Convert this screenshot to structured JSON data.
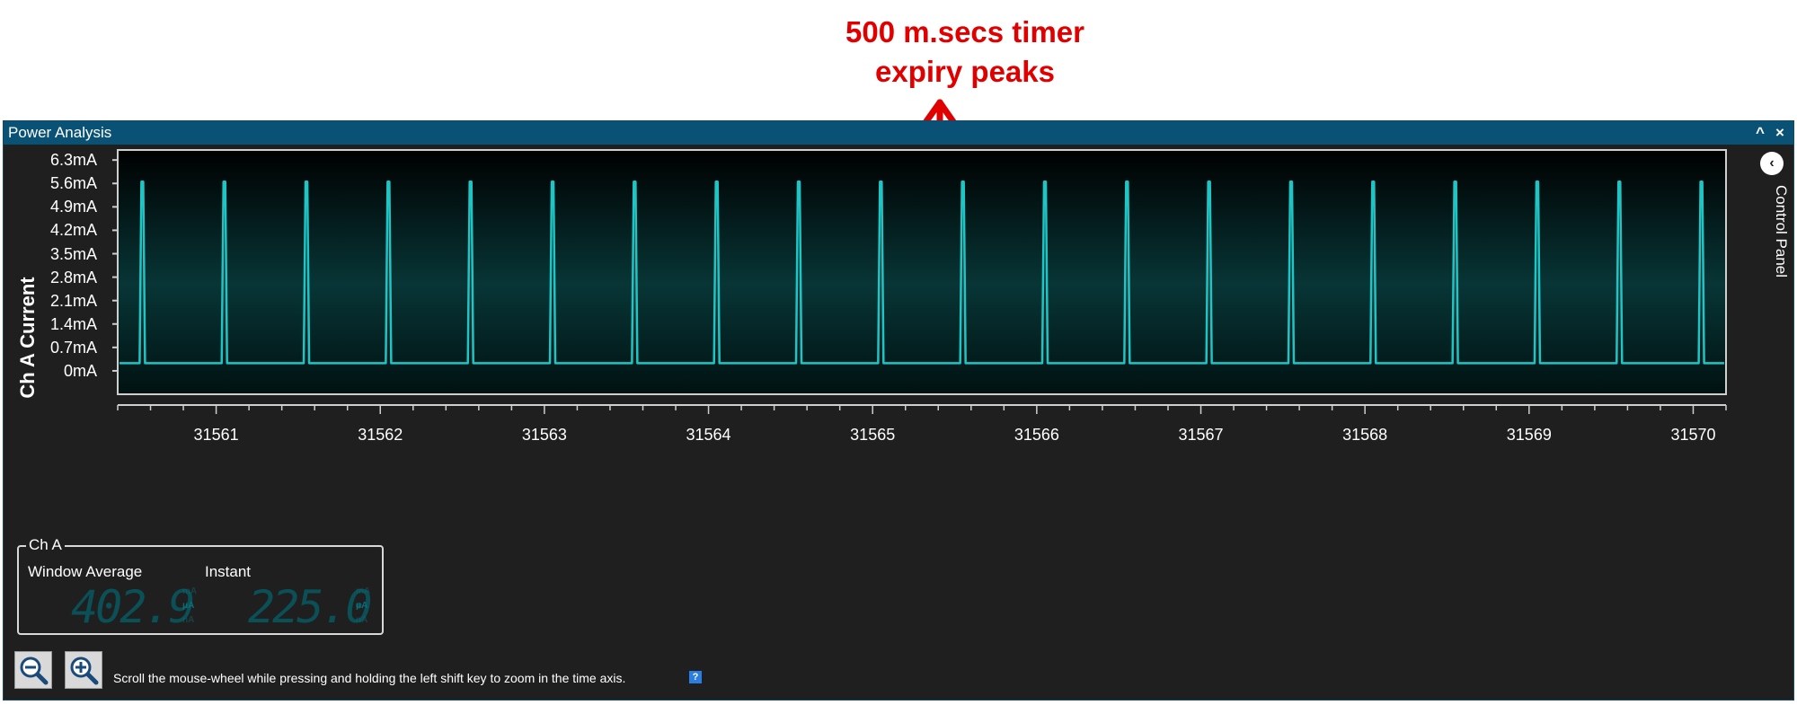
{
  "annotation": {
    "line1": "500 m.secs timer",
    "line2": "expiry peaks"
  },
  "window": {
    "title": "Power Analysis",
    "minimize_glyph": "^",
    "close_glyph": "×"
  },
  "chart_data": {
    "type": "line",
    "ylabel": "Ch A Current",
    "yticks": [
      "6.3mA",
      "5.6mA",
      "4.9mA",
      "4.2mA",
      "3.5mA",
      "2.8mA",
      "2.1mA",
      "1.4mA",
      "0.7mA",
      "0mA"
    ],
    "ylim": [
      -0.7,
      6.6
    ],
    "xticks": [
      "31561",
      "31562",
      "31563",
      "31564",
      "31565",
      "31566",
      "31567",
      "31568",
      "31569",
      "31570"
    ],
    "xlim": [
      31560.4,
      31570.2
    ],
    "baseline": 0.23,
    "peak": 5.65,
    "peak_times": [
      31560.55,
      31561.05,
      31561.55,
      31562.05,
      31562.55,
      31563.05,
      31563.55,
      31564.05,
      31564.55,
      31565.05,
      31565.55,
      31566.05,
      31566.55,
      31567.05,
      31567.55,
      31568.05,
      31568.55,
      31569.05,
      31569.55,
      31570.05
    ],
    "grid": false,
    "line_color": "#1fc4c4"
  },
  "control_panel": {
    "label": "Control Panel",
    "toggle_glyph": "‹"
  },
  "channel": {
    "name": "Ch A",
    "window_average_label": "Window Average",
    "window_average_value": "402.9",
    "instant_label": "Instant",
    "instant_value": "225.0",
    "unit_mA": "mA",
    "unit_uA": "μA",
    "unit_nA": "nA"
  },
  "footer": {
    "hint": "Scroll the mouse-wheel while pressing and holding the left shift key to zoom in the time axis.",
    "help_glyph": "?"
  },
  "icons": {
    "zoom_out": "zoom-out-icon",
    "zoom_in": "zoom-in-icon"
  }
}
